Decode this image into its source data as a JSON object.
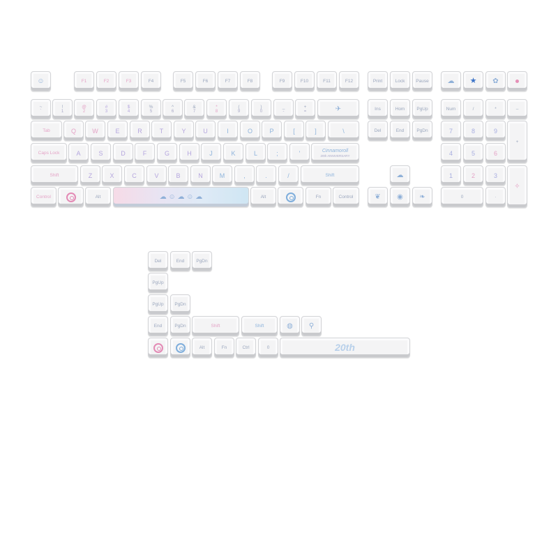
{
  "keyboard": {
    "function_row": [
      {
        "label": "☺",
        "icon": "face-icon"
      },
      {
        "label": "F1"
      },
      {
        "label": "F2"
      },
      {
        "label": "F3"
      },
      {
        "label": "F4"
      },
      {
        "label": "F5"
      },
      {
        "label": "F6"
      },
      {
        "label": "F7"
      },
      {
        "label": "F8"
      },
      {
        "label": "F9"
      },
      {
        "label": "F10"
      },
      {
        "label": "F11"
      },
      {
        "label": "F12"
      },
      {
        "label": "Print"
      },
      {
        "label": "Lock"
      },
      {
        "label": "Pause"
      },
      {
        "label": "",
        "icon": "cloud-icon"
      },
      {
        "label": "★",
        "icon": "star-icon"
      },
      {
        "label": "",
        "icon": "flower-icon"
      },
      {
        "label": "",
        "icon": "heart-icon"
      }
    ],
    "number_row": [
      {
        "top": "~",
        "bottom": "`"
      },
      {
        "top": "!",
        "bottom": "1"
      },
      {
        "top": "@",
        "bottom": "2"
      },
      {
        "top": "#",
        "bottom": "3"
      },
      {
        "top": "$",
        "bottom": "4"
      },
      {
        "top": "%",
        "bottom": "5"
      },
      {
        "top": "^",
        "bottom": "6"
      },
      {
        "top": "&",
        "bottom": "7"
      },
      {
        "top": "*",
        "bottom": "8"
      },
      {
        "top": "(",
        "bottom": "9"
      },
      {
        "top": ")",
        "bottom": "0"
      },
      {
        "top": "_",
        "bottom": "-"
      },
      {
        "top": "+",
        "bottom": "="
      },
      {
        "label": "",
        "icon": "airplane-icon"
      }
    ],
    "qwerty_row": [
      "Tab",
      "Q",
      "W",
      "E",
      "R",
      "T",
      "Y",
      "U",
      "I",
      "O",
      "P",
      "[",
      "]",
      "\\"
    ],
    "home_row": [
      "Caps Lock",
      "A",
      "S",
      "D",
      "F",
      "G",
      "H",
      "J",
      "K",
      "L",
      ";",
      "'",
      "Cinnamoroll"
    ],
    "home_row_sub": {
      "anniversary": "20th ANNIVERSARY"
    },
    "shift_row": [
      "Shift",
      "Z",
      "X",
      "C",
      "V",
      "B",
      "N",
      "M",
      ",",
      ".",
      "/",
      "Shift"
    ],
    "bottom_row": [
      "Control",
      "",
      "Alt",
      "",
      "Alt",
      "",
      "Fn",
      "Control"
    ],
    "nav_cluster": {
      "row1": [
        "Ins",
        "Hom",
        "PgUp"
      ],
      "row2": [
        "Del",
        "End",
        "PgDn"
      ]
    },
    "numpad": {
      "row0": [
        "Num",
        "/",
        "*",
        "–"
      ],
      "row1": [
        "7",
        "8",
        "9"
      ],
      "row2": [
        "4",
        "5",
        "6"
      ],
      "row3": [
        "1",
        "2",
        "3"
      ],
      "row4": [
        "0",
        "·"
      ],
      "plus": "+"
    },
    "extras": {
      "row1": [
        "Del",
        "End",
        "PgDn"
      ],
      "row2": [
        "PgUp"
      ],
      "row3": [
        "PgUp",
        "PgDn"
      ],
      "row4": [
        "End",
        "PgDn",
        "Shift",
        "Shift"
      ],
      "row5": [
        "",
        "",
        "Alt",
        "Fn",
        "Ctrl",
        "0"
      ],
      "space_badge": "20th"
    }
  }
}
